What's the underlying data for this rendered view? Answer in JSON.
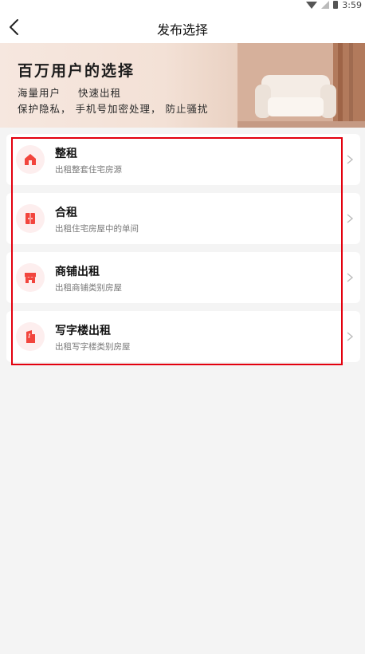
{
  "status_bar": {
    "time": "3:59"
  },
  "header": {
    "title": "发布选择"
  },
  "banner": {
    "title": "百万用户的选择",
    "line1": "海量用户  快速出租",
    "line2": "保护隐私， 手机号加密处理， 防止骚扰"
  },
  "options": [
    {
      "title": "整租",
      "subtitle": "出租整套住宅房源",
      "icon": "house-icon"
    },
    {
      "title": "合租",
      "subtitle": "出租住宅房屋中的单间",
      "icon": "door-icon"
    },
    {
      "title": "商铺出租",
      "subtitle": "出租商铺类别房屋",
      "icon": "shop-icon"
    },
    {
      "title": "写字楼出租",
      "subtitle": "出租写字楼类别房屋",
      "icon": "office-building-icon"
    }
  ],
  "colors": {
    "accent": "#f2453d",
    "icon_bg": "#fdeeee",
    "highlight_border": "#e3000e",
    "page_bg": "#f4f4f4"
  }
}
